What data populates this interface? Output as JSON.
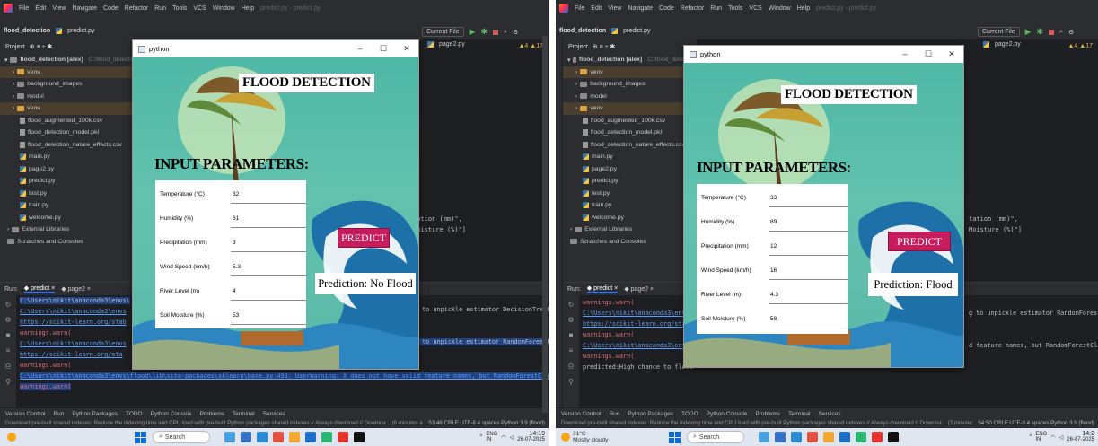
{
  "left": {
    "menu": [
      "File",
      "Edit",
      "View",
      "Navigate",
      "Code",
      "Refactor",
      "Run",
      "Tools",
      "VCS",
      "Window",
      "Help"
    ],
    "menu_title": "predict.py - predict.py",
    "breadcrumb": {
      "project": "flood_detection",
      "file": "predict.py"
    },
    "current_file_label": "Current File",
    "tab_page2": "page2.py",
    "warnings": {
      "warn": "4",
      "weak": "17"
    },
    "project_label": "Project",
    "tree": [
      {
        "label": "flood_detection [alex]",
        "hint": "C:\\flood_detection"
      },
      {
        "label": "venv",
        "type": "folder-orange"
      },
      {
        "label": "background_images",
        "type": "folder"
      },
      {
        "label": "model",
        "type": "folder"
      },
      {
        "label": "venv",
        "type": "folder-orange"
      },
      {
        "label": "flood_augmented_100k.csv",
        "type": "file"
      },
      {
        "label": "flood_detection_model.pkl",
        "type": "file"
      },
      {
        "label": "flood_detection_nature_effects.csv",
        "type": "file"
      },
      {
        "label": "main.py",
        "type": "py"
      },
      {
        "label": "page2.py",
        "type": "py"
      },
      {
        "label": "predict.py",
        "type": "py"
      },
      {
        "label": "test.py",
        "type": "py"
      },
      {
        "label": "train.py",
        "type": "py"
      },
      {
        "label": "welcome.py",
        "type": "py"
      },
      {
        "label": "External Libraries",
        "type": "folder"
      },
      {
        "label": "Scratches and Consoles",
        "type": "folder"
      }
    ],
    "code": [
      "tation (mm)\",",
      "Moisture (%)\"]"
    ],
    "run": {
      "label": "Run:",
      "tab1": "predict",
      "tab2": "page2",
      "lines": [
        {
          "text": "C:\\Users\\nikit\\anaconda3\\envs\\",
          "cls": "rl-text"
        },
        {
          "text": "C:\\Users\\nikit\\anaconda3\\envs",
          "cls": "rl-link"
        },
        {
          "text": "https://scikit-learn.org/stab",
          "cls": "rl-link"
        },
        {
          "text": "warnings.warn(",
          "cls": "rl-warn"
        },
        {
          "text": "C:\\Users\\nikit\\anaconda3\\envs",
          "cls": "rl-link"
        },
        {
          "text": "https://scikit-learn.org/sta",
          "cls": "rl-link"
        },
        {
          "text": "warnings.warn(",
          "cls": "rl-warn"
        },
        {
          "text": "C:\\Users\\nikit\\anaconda3\\envs\\flood\\lib\\site-packages\\sklearn\\base.py:493: UserWarning: X does not have valid feature names, but RandomForestClass",
          "cls": "rl-link"
        },
        {
          "text": "warnings.warn(",
          "cls": "rl-warn"
        }
      ],
      "right_snips": [
        "g to unpickle estimator DecisionTreeCl",
        "g to unpickle estimator RandomForestCl"
      ]
    },
    "toolstrip": [
      "Version Control",
      "Run",
      "Python Packages",
      "TODO",
      "Python Console",
      "Problems",
      "Terminal",
      "Services"
    ],
    "status": "Download pre-built shared indexes: Reduce the indexing time and CPU load with pre-built Python packages shared indexes // Always download // Downloa... (6 minutes ago",
    "status_right": "53:46  CRLF  UTF-8  4 spaces  Python 3.9 (flood)",
    "taskbar": {
      "search": "Search",
      "lang": "ENG",
      "lang2": "IN",
      "time": "14:19",
      "date": "26-07-2025"
    },
    "app": {
      "window_title": "python",
      "title": "FLOOD DETECTION",
      "input_title": "INPUT PARAMETERS:",
      "fields": [
        {
          "label": "Temperature (°C)",
          "value": "32"
        },
        {
          "label": "Humidity (%)",
          "value": "61"
        },
        {
          "label": "Precipitation (mm)",
          "value": "3"
        },
        {
          "label": "Wind Speed (km/h)",
          "value": "5.3"
        },
        {
          "label": "River Level (m)",
          "value": "4"
        },
        {
          "label": "Soil Moisture (%)",
          "value": "53"
        }
      ],
      "predict_label": "PREDICT",
      "result": "Prediction: No Flood"
    }
  },
  "right": {
    "menu": [
      "File",
      "Edit",
      "View",
      "Navigate",
      "Code",
      "Refactor",
      "Run",
      "Tools",
      "VCS",
      "Window",
      "Help"
    ],
    "menu_title": "predict.py - predict.py",
    "breadcrumb": {
      "project": "flood_detection",
      "file": "predict.py"
    },
    "current_file_label": "Current File",
    "tab_page2": "page2.py",
    "warnings": {
      "warn": "4",
      "weak": "17"
    },
    "project_label": "Project",
    "tree": [
      {
        "label": "flood_detection [alex]",
        "hint": "C:\\flood_detection"
      },
      {
        "label": "venv",
        "type": "folder-orange"
      },
      {
        "label": "background_images",
        "type": "folder"
      },
      {
        "label": "model",
        "type": "folder"
      },
      {
        "label": "venv",
        "type": "folder-orange"
      },
      {
        "label": "flood_augmented_100k.csv",
        "type": "file"
      },
      {
        "label": "flood_detection_model.pkl",
        "type": "file"
      },
      {
        "label": "flood_detection_nature_effects.csv",
        "type": "file"
      },
      {
        "label": "main.py",
        "type": "py"
      },
      {
        "label": "page2.py",
        "type": "py"
      },
      {
        "label": "predict.py",
        "type": "py"
      },
      {
        "label": "test.py",
        "type": "py"
      },
      {
        "label": "train.py",
        "type": "py"
      },
      {
        "label": "welcome.py",
        "type": "py"
      },
      {
        "label": "External Libraries",
        "type": "folder"
      },
      {
        "label": "Scratches and Consoles",
        "type": "folder"
      }
    ],
    "code": [
      "tation (mm)\",",
      "Moisture (%)\"]"
    ],
    "run": {
      "label": "Run:",
      "tab1": "predict",
      "tab2": "page2",
      "lines": [
        {
          "text": "warnings.warn(",
          "cls": "rl-warn"
        },
        {
          "text": "C:\\Users\\nikit\\anaconda3\\envs",
          "cls": "rl-link"
        },
        {
          "text": "https://scikit-learn.org/stab",
          "cls": "rl-link"
        },
        {
          "text": "warnings.warn(",
          "cls": "rl-warn"
        },
        {
          "text": "C:\\Users\\nikit\\anaconda3\\envs",
          "cls": "rl-link"
        },
        {
          "text": "warnings.warn(",
          "cls": "rl-warn"
        },
        {
          "text": "predicted:High chance to flood",
          "cls": "rl-text"
        }
      ],
      "right_snips": [
        "g to unpickle estimator RandomForestC",
        "d feature names, but RandomForestClas"
      ]
    },
    "toolstrip": [
      "Version Control",
      "Run",
      "Python Packages",
      "TODO",
      "Python Console",
      "Problems",
      "Terminal",
      "Services"
    ],
    "status": "Download pre-built shared indexes: Reduce the indexing time and CPU load with pre-built Python packages shared indexes // Always download // Downloa... (7 minutes ago",
    "status_right": "54:50  CRLF  UTF-8  4 spaces  Python 3.9 (flood)",
    "taskbar": {
      "weather_temp": "31°C",
      "weather_desc": "Mostly cloudy",
      "search": "Search",
      "lang": "ENG",
      "lang2": "IN",
      "time": "14:2",
      "date": "26-07-2025"
    },
    "app": {
      "window_title": "python",
      "title": "FLOOD DETECTION",
      "input_title": "INPUT PARAMETERS:",
      "fields": [
        {
          "label": "Temperature (°C)",
          "value": "33"
        },
        {
          "label": "Humidity (%)",
          "value": "89"
        },
        {
          "label": "Precipitation (mm)",
          "value": "12"
        },
        {
          "label": "Wind Speed (km/h)",
          "value": "16"
        },
        {
          "label": "River Level (m)",
          "value": "4.3"
        },
        {
          "label": "Soil Moisture (%)",
          "value": "58"
        }
      ],
      "predict_label": "PREDICT",
      "result": "Prediction: Flood"
    }
  }
}
